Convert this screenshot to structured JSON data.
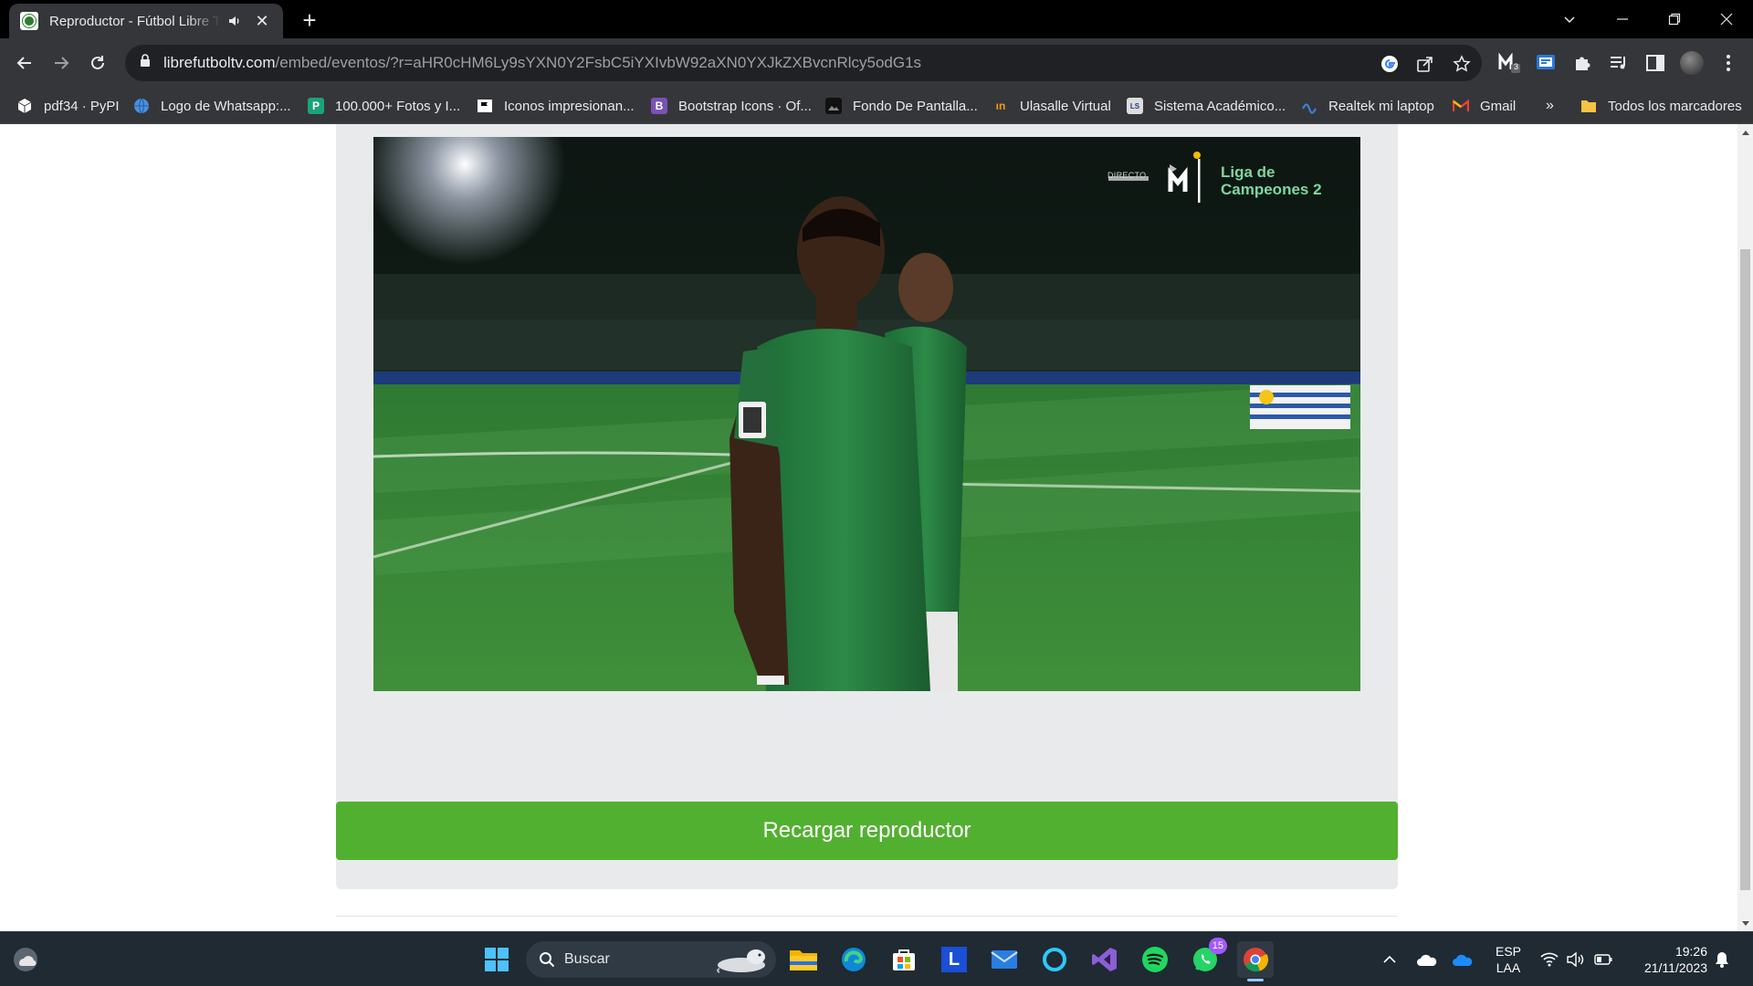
{
  "browser": {
    "tab": {
      "title": "Reproductor - Fútbol Libre TV",
      "favicon_icon": "soccer-ball-icon",
      "audio_icon": "speaker-icon",
      "close_label": "✕"
    },
    "new_tab_label": "+",
    "url": {
      "host": "librefutboltv.com",
      "path": "/embed/eventos/?r=aHR0cHM6Ly9sYXN0Y2FsbC5iYXIvbW92aXN0YXJkZXBvcnRlcy5odG1s"
    },
    "bookmarks": [
      {
        "label": "pdf34 · PyPI",
        "icon": "cube-icon",
        "color": "#ffffff"
      },
      {
        "label": "Logo de Whatsapp:...",
        "icon": "globe-icon",
        "color": "#4a90e2"
      },
      {
        "label": "100.000+ Fotos y I...",
        "icon": "photo-icon",
        "color": "#1aa37a"
      },
      {
        "label": "Iconos impresionan...",
        "icon": "flag-icon",
        "color": "#ffffff"
      },
      {
        "label": "Bootstrap Icons · Of...",
        "icon": "bootstrap-icon",
        "color": "#7952b3"
      },
      {
        "label": "Fondo De Pantalla...",
        "icon": "image-icon",
        "color": "#222222"
      },
      {
        "label": "Ulasalle Virtual",
        "icon": "ulasalle-icon",
        "color": "#f39c12"
      },
      {
        "label": "Sistema Académico...",
        "icon": "lasalle-icon",
        "color": "#dddddd"
      },
      {
        "label": "Realtek mi laptop",
        "icon": "realtek-icon",
        "color": "#2b6cb0"
      },
      {
        "label": "Gmail",
        "icon": "gmail-icon",
        "color": "#ea4335"
      }
    ],
    "bookmarks_overflow": "»",
    "all_bookmarks": "Todos los marcadores",
    "extensions_badge": "3"
  },
  "page": {
    "video_overlay": {
      "live_label": "DIRECTO",
      "channel_text": "Liga de Campeones 2"
    },
    "reload_button": "Recargar reproductor"
  },
  "taskbar": {
    "search_placeholder": "Buscar",
    "whatsapp_badge": "15",
    "language": "ESP",
    "layout": "LAA",
    "time": "19:26",
    "date": "21/11/2023"
  },
  "colors": {
    "reload_button": "#52b030",
    "player_card": "#e9eaec",
    "browser_chrome": "#35363a"
  }
}
